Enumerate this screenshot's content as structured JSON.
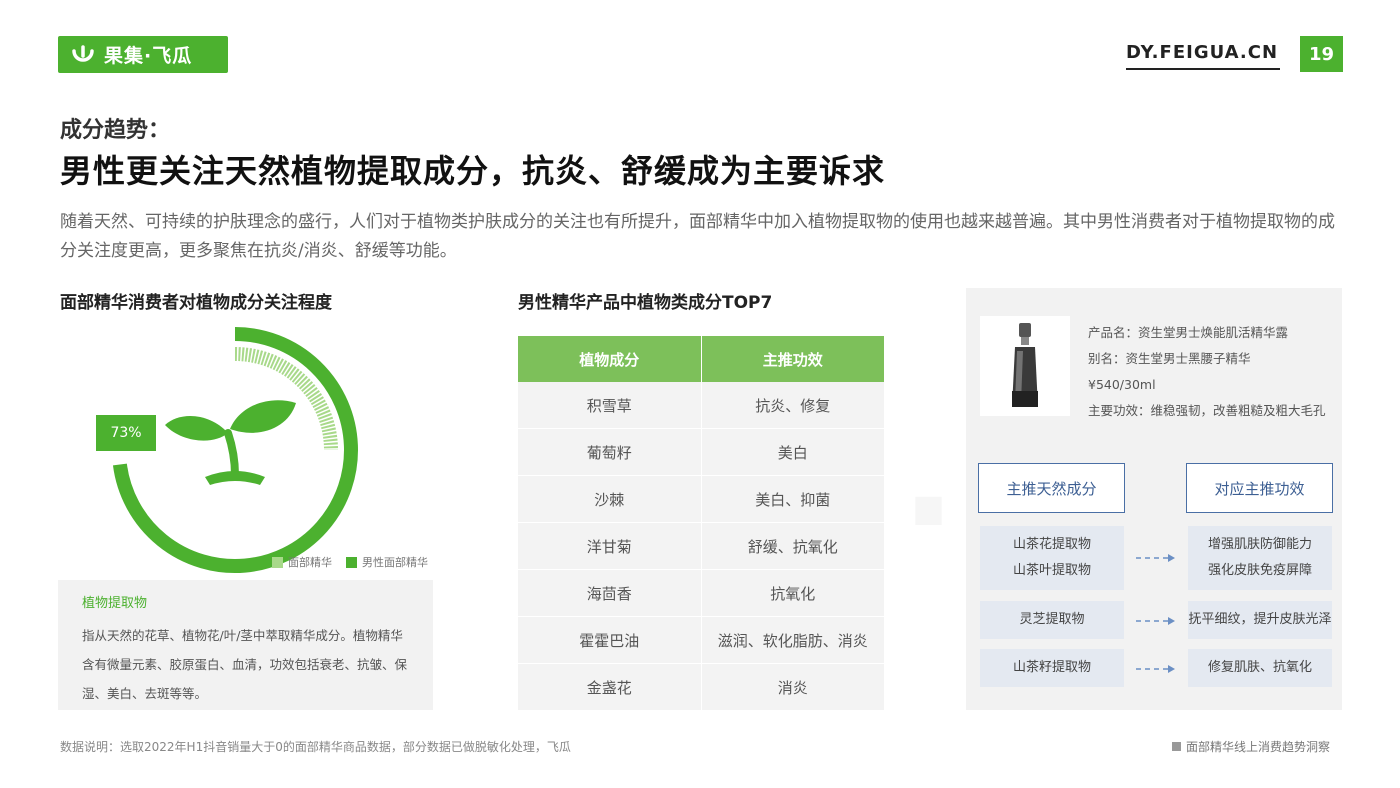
{
  "brand": {
    "logo_text": "果集·飞瓜",
    "site": "DY.FEIGUA.CN",
    "page_number": "19",
    "accent": "#4cb12f"
  },
  "header": {
    "eyebrow": "成分趋势：",
    "headline": "男性更关注天然植物提取成分，抗炎、舒缓成为主要诉求",
    "intro": "随着天然、可持续的护肤理念的盛行，人们对于植物类护肤成分的关注也有所提升，面部精华中加入植物提取物的使用也越来越普遍。其中男性消费者对于植物提取物的成分关注度更高，更多聚焦在抗炎/消炎、舒缓等功能。"
  },
  "left": {
    "title": "面部精华消费者对植物成分关注程度",
    "definition_title": "植物提取物",
    "definition_text": "指从天然的花草、植物花/叶/茎中萃取精华成分。植物精华含有微量元素、胶原蛋白、血清，功效包括衰老、抗皱、保湿、美白、去斑等等。"
  },
  "chart_data": {
    "type": "donut",
    "series": [
      {
        "name": "面部精华",
        "color": "#a8d98a"
      },
      {
        "name": "男性面部精华",
        "value": 73,
        "label": "73%",
        "color": "#4cb12f"
      }
    ],
    "unit": "%"
  },
  "middle": {
    "title": "男性精华产品中植物类成分TOP7",
    "columns": [
      "植物成分",
      "主推功效"
    ],
    "rows": [
      [
        "积雪草",
        "抗炎、修复"
      ],
      [
        "葡萄籽",
        "美白"
      ],
      [
        "沙棘",
        "美白、抑菌"
      ],
      [
        "洋甘菊",
        "舒缓、抗氧化"
      ],
      [
        "海茴香",
        "抗氧化"
      ],
      [
        "霍霍巴油",
        "滋润、软化脂肪、消炎"
      ],
      [
        "金盏花",
        "消炎"
      ]
    ]
  },
  "product": {
    "name": "产品名：资生堂男士焕能肌活精华露",
    "alias": "别名：资生堂男士黑腰子精华",
    "price": "¥540/30ml",
    "effect": "主要功效：维稳强韧，改善粗糙及粗大毛孔",
    "col_left": "主推天然成分",
    "col_right": "对应主推功效",
    "pairs": [
      {
        "ingredient": [
          "山茶花提取物",
          "山茶叶提取物"
        ],
        "effect": [
          "增强肌肤防御能力",
          "强化皮肤免疫屏障"
        ]
      },
      {
        "ingredient": [
          "灵芝提取物"
        ],
        "effect": [
          "抚平细纹，提升皮肤光泽"
        ]
      },
      {
        "ingredient": [
          "山茶籽提取物"
        ],
        "effect": [
          "修复肌肤、抗氧化"
        ]
      }
    ]
  },
  "footer": {
    "note": "数据说明：选取2022年H1抖音销量大于0的面部精华商品数据，部分数据已做脱敏化处理，飞瓜",
    "report": "面部精华线上消费趋势洞察"
  }
}
